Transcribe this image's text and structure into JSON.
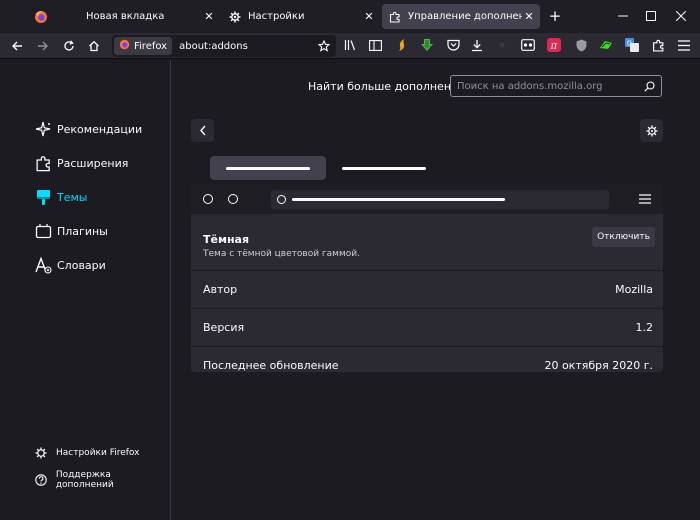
{
  "tabs": [
    {
      "title": "Новая вкладка",
      "icon": "firefox-logo-icon"
    },
    {
      "title": "Настройки",
      "icon": "gear-icon"
    },
    {
      "title": "Управление дополнениями",
      "icon": "puzzle-icon",
      "selected": true
    }
  ],
  "toolbar": {
    "identity_label": "Firefox",
    "url": "about:addons"
  },
  "sidebar": {
    "categories": [
      {
        "label": "Рекомендации",
        "icon": "sparkle-icon"
      },
      {
        "label": "Расширения",
        "icon": "puzzle-icon"
      },
      {
        "label": "Темы",
        "icon": "brush-icon",
        "selected": true
      },
      {
        "label": "Плагины",
        "icon": "plugin-icon"
      },
      {
        "label": "Словари",
        "icon": "dictionary-icon"
      }
    ],
    "footer": [
      {
        "label": "Настройки Firefox",
        "icon": "gear-icon"
      },
      {
        "label": "Поддержка дополнений",
        "icon": "help-icon"
      }
    ]
  },
  "main": {
    "find_more_label": "Найти больше дополнений",
    "search_placeholder": "Поиск на addons.mozilla.org",
    "addon": {
      "name": "Тёмная",
      "description": "Тема с тёмной цветовой гаммой.",
      "disable_label": "Отключить",
      "details": [
        {
          "label": "Автор",
          "value": "Mozilla"
        },
        {
          "label": "Версия",
          "value": "1.2"
        },
        {
          "label": "Последнее обновление",
          "value": "20 октября 2020 г."
        }
      ]
    }
  },
  "colors": {
    "accent": "#00ddff",
    "background": "#1c1b22",
    "surface": "#2b2a33"
  }
}
